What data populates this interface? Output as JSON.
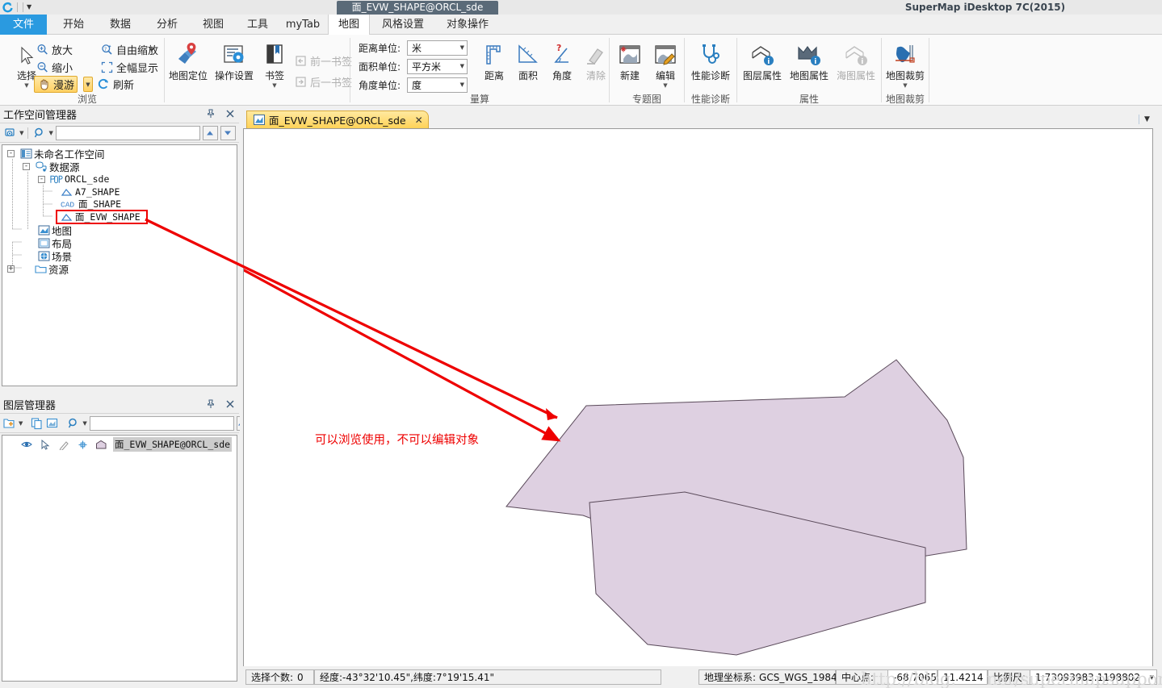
{
  "window": {
    "document_title": "面_EVW_SHAPE@ORCL_sde",
    "app_title": "SuperMap iDesktop 7C(2015)",
    "qat_dropdown_icon": "chevron-down-icon",
    "logo_icon": "supermap-logo-icon"
  },
  "ribbon": {
    "tabs": [
      {
        "label": "文件",
        "state": "file"
      },
      {
        "label": "开始",
        "state": "normal"
      },
      {
        "label": "数据",
        "state": "normal"
      },
      {
        "label": "分析",
        "state": "normal"
      },
      {
        "label": "视图",
        "state": "normal"
      },
      {
        "label": "工具",
        "state": "normal"
      },
      {
        "label": "myTab",
        "state": "normal"
      },
      {
        "label": "地图",
        "state": "active"
      },
      {
        "label": "风格设置",
        "state": "normal"
      },
      {
        "label": "对象操作",
        "state": "normal"
      }
    ],
    "groups": [
      {
        "label": "浏览"
      },
      {
        "label": "量算"
      },
      {
        "label": "专题图"
      },
      {
        "label": "性能诊断"
      },
      {
        "label": "属性"
      },
      {
        "label": "地图裁剪"
      }
    ],
    "browse": {
      "select_label": "选择",
      "select_icon": "cursor-arrow-icon",
      "zoom_in_label": "放大",
      "zoom_in_icon": "magnifier-plus-icon",
      "zoom_out_label": "缩小",
      "zoom_out_icon": "magnifier-minus-icon",
      "pan_label": "漫游",
      "pan_icon": "hand-icon",
      "free_zoom_label": "自由缩放",
      "free_zoom_icon": "magnifier-star-icon",
      "full_extent_label": "全幅显示",
      "full_extent_icon": "full-extent-icon",
      "refresh_label": "刷新",
      "refresh_icon": "refresh-icon",
      "map_locate_label": "地图定位",
      "map_locate_icon": "map-pin-icon",
      "operation_settings_label": "操作设置",
      "operation_settings_icon": "settings-gear-icon",
      "bookmark_label": "书签",
      "bookmark_icon": "bookmark-icon",
      "prev_bookmark_label": "前一书签",
      "prev_bookmark_icon": "prev-bookmark-icon",
      "next_bookmark_label": "后一书签",
      "next_bookmark_icon": "next-bookmark-icon"
    },
    "measure": {
      "distance_unit_label": "距离单位:",
      "distance_unit_value": "米",
      "area_unit_label": "面积单位:",
      "area_unit_value": "平方米",
      "angle_unit_label": "角度单位:",
      "angle_unit_value": "度",
      "distance_label": "距离",
      "distance_icon": "ruler-distance-icon",
      "area_label": "面积",
      "area_icon": "ruler-area-icon",
      "angle_label": "角度",
      "angle_icon": "angle-icon",
      "clear_label": "清除",
      "clear_icon": "eraser-icon"
    },
    "thematic": {
      "new_label": "新建",
      "new_icon": "thematic-new-icon",
      "edit_label": "编辑",
      "edit_icon": "thematic-edit-icon"
    },
    "diagnose": {
      "perf_label": "性能诊断",
      "perf_icon": "stethoscope-icon"
    },
    "attributes": {
      "layer_prop_label": "图层属性",
      "layer_prop_icon": "layer-info-icon",
      "map_prop_label": "地图属性",
      "map_prop_icon": "map-info-icon",
      "chart_prop_label": "海图属性",
      "chart_prop_icon": "chart-info-icon"
    },
    "clip": {
      "map_clip_label": "地图裁剪",
      "map_clip_icon": "map-clip-icon"
    }
  },
  "workspace_panel": {
    "title": "工作空间管理器",
    "pin_icon": "pin-icon",
    "close_icon": "close-icon",
    "toolbar": {
      "view_icon": "workspace-view-icon",
      "search_icon": "search-icon",
      "search_value": "",
      "up_icon": "arrow-up-icon",
      "down_icon": "arrow-down-icon"
    },
    "tree": [
      {
        "label": "未命名工作空间",
        "icon": "workspace-icon",
        "indent": 0,
        "expander": "-"
      },
      {
        "label": "数据源",
        "icon": "datasource-group-icon",
        "indent": 1,
        "expander": "-"
      },
      {
        "label": "ORCL_sde",
        "icon": "oracle-db-icon",
        "indent": 2,
        "expander": "-",
        "mono": true
      },
      {
        "label": "A7_SHAPE",
        "icon": "polygon-dataset-icon",
        "indent": 3,
        "expander": "",
        "mono": true
      },
      {
        "label": "面_SHAPE",
        "icon": "cad-dataset-icon",
        "indent": 3,
        "expander": "",
        "mono": true
      },
      {
        "label": "面_EVW_SHAPE",
        "icon": "polygon-dataset-icon",
        "indent": 3,
        "expander": "",
        "mono": true,
        "highlight": true
      },
      {
        "label": "地图",
        "icon": "map-folder-icon",
        "indent": 1,
        "expander": ""
      },
      {
        "label": "布局",
        "icon": "layout-folder-icon",
        "indent": 1,
        "expander": ""
      },
      {
        "label": "场景",
        "icon": "scene-folder-icon",
        "indent": 1,
        "expander": ""
      },
      {
        "label": "资源",
        "icon": "resource-folder-icon",
        "indent": 1,
        "expander": "+"
      }
    ]
  },
  "layer_panel": {
    "title": "图层管理器",
    "pin_icon": "pin-icon",
    "close_icon": "close-icon",
    "toolbar": {
      "add_layer_icon": "add-layer-icon",
      "copy_icon": "copy-layers-icon",
      "props_icon": "layer-props-icon",
      "search_icon": "search-icon",
      "search_value": "",
      "up_icon": "arrow-up-icon",
      "down_icon": "arrow-down-icon"
    },
    "layers": [
      {
        "label": "面_EVW_SHAPE@ORCL_sde",
        "visible_icon": "eye-icon",
        "selectable_icon": "cursor-arrow-icon",
        "editable_icon": "pencil-icon",
        "snap_icon": "snap-icon",
        "style_icon": "polygon-style-icon",
        "selected": true
      }
    ]
  },
  "map_view": {
    "tab": {
      "label": "面_EVW_SHAPE@ORCL_sde",
      "icon": "map-window-icon",
      "close_icon": "close-icon"
    },
    "tab_menu_icon": "chevron-down-icon",
    "annotation": "可以浏览使用，不可以编辑对象",
    "annotation_color": "#ee0000",
    "polygon_fill": "#ded0e1",
    "polygon_stroke": "#5a4a5a",
    "background": "#ffffff"
  },
  "status_bar": {
    "selected_count_label": "选择个数:",
    "selected_count_value": "0",
    "coordinates": "经度:-43°32'10.45\",纬度:7°19'15.41\"",
    "crs_label": "地理坐标系:",
    "crs_value": "GCS_WGS_1984",
    "center_label": "中心点:",
    "center_x": "-68.7065",
    "center_y": "11.4214",
    "scale_label": "比例尺:",
    "scale_value": "1:73093983.1198802",
    "scale_dropdown_icon": "chevron-down-icon"
  },
  "watermark": {
    "text_left": "http://blog.",
    "text_right": "net/supermapsupport"
  }
}
